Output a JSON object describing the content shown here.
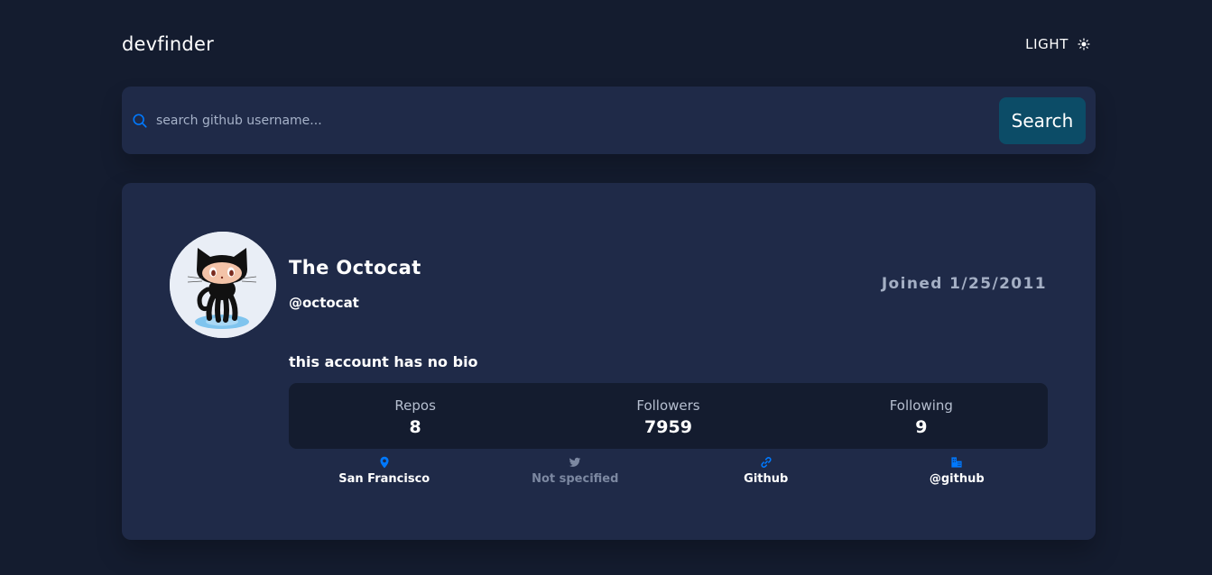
{
  "header": {
    "logo": "devfinder",
    "theme_toggle_label": "LIGHT",
    "theme_icon": "sun-icon"
  },
  "search": {
    "placeholder": "search github username...",
    "value": "",
    "button_label": "Search",
    "icon": "search-icon"
  },
  "profile": {
    "name": "The Octocat",
    "login": "@octocat",
    "joined": "Joined 1/25/2011",
    "bio": "this account has no bio",
    "avatar": "octocat-avatar"
  },
  "stats": [
    {
      "label": "Repos",
      "value": "8"
    },
    {
      "label": "Followers",
      "value": "7959"
    },
    {
      "label": "Following",
      "value": "9"
    }
  ],
  "links": [
    {
      "icon": "location-pin-icon",
      "text": "San Francisco",
      "available": true
    },
    {
      "icon": "twitter-icon",
      "text": "Not specified",
      "available": false
    },
    {
      "icon": "link-icon",
      "text": "Github",
      "available": true
    },
    {
      "icon": "company-building-icon",
      "text": "@github",
      "available": true
    }
  ],
  "colors": {
    "background": "#141c2f",
    "card": "#1f2a48",
    "accent_icon": "#0079ff",
    "button": "#0c4c67",
    "muted_text": "#a4afc4"
  }
}
